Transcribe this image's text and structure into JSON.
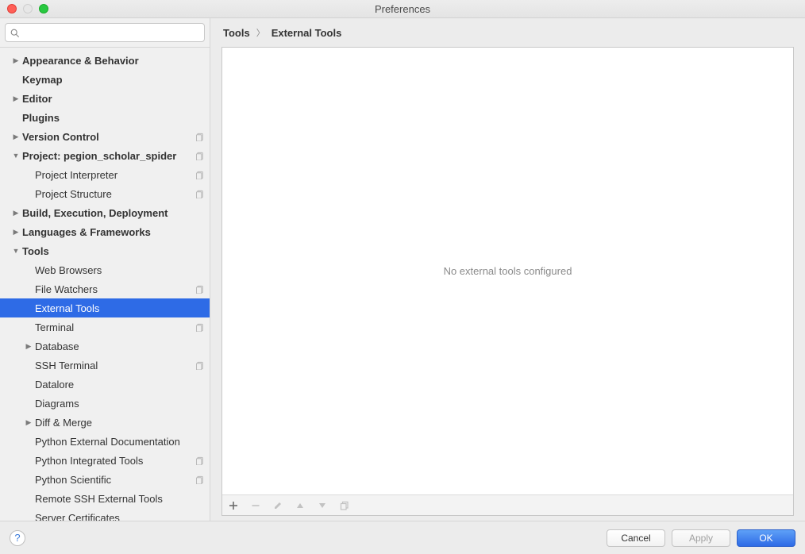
{
  "window": {
    "title": "Preferences"
  },
  "search": {
    "placeholder": ""
  },
  "breadcrumb": {
    "root": "Tools",
    "current": "External Tools"
  },
  "panel": {
    "empty_text": "No external tools configured"
  },
  "toolbar": {
    "add": "+",
    "remove": "−",
    "edit": "✎",
    "up": "▲",
    "down": "▼",
    "copy": "⧉"
  },
  "buttons": {
    "cancel": "Cancel",
    "apply": "Apply",
    "ok": "OK"
  },
  "tree": {
    "appearance": "Appearance & Behavior",
    "keymap": "Keymap",
    "editor": "Editor",
    "plugins": "Plugins",
    "version_control": "Version Control",
    "project": "Project: pegion_scholar_spider",
    "project_interpreter": "Project Interpreter",
    "project_structure": "Project Structure",
    "build": "Build, Execution, Deployment",
    "languages": "Languages & Frameworks",
    "tools": "Tools",
    "web_browsers": "Web Browsers",
    "file_watchers": "File Watchers",
    "external_tools": "External Tools",
    "terminal": "Terminal",
    "database": "Database",
    "ssh_terminal": "SSH Terminal",
    "datalore": "Datalore",
    "diagrams": "Diagrams",
    "diff_merge": "Diff & Merge",
    "py_ext_doc": "Python External Documentation",
    "py_int_tools": "Python Integrated Tools",
    "py_scientific": "Python Scientific",
    "remote_ssh": "Remote SSH External Tools",
    "server_certs": "Server Certificates"
  }
}
